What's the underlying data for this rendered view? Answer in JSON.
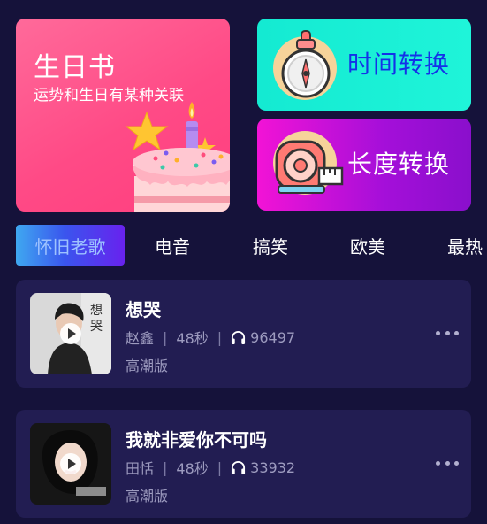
{
  "cards": {
    "birthday": {
      "title": "生日书",
      "subtitle": "运势和生日有某种关联",
      "icon": "birthday-cake-icon",
      "color": "#ff4a86"
    },
    "time": {
      "label": "时间转换",
      "icon": "compass-clock-icon",
      "color": "#1ff4d9"
    },
    "length": {
      "label": "长度转换",
      "icon": "tape-measure-icon",
      "color": "#c412d8"
    }
  },
  "tabs": [
    {
      "label": "怀旧老歌",
      "active": true
    },
    {
      "label": "电音",
      "active": false
    },
    {
      "label": "搞笑",
      "active": false
    },
    {
      "label": "欧美",
      "active": false
    },
    {
      "label": "最热",
      "active": false
    }
  ],
  "songs": [
    {
      "title": "想哭",
      "artist": "赵鑫",
      "duration": "48秒",
      "plays": "96497",
      "version": "高潮版"
    },
    {
      "title": "我就非爱你不可吗",
      "artist": "田恬",
      "duration": "48秒",
      "plays": "33932",
      "version": "高潮版"
    }
  ],
  "theme": {
    "background": "#15123a",
    "card_background": "#221d52",
    "muted_text": "#9d9bbf"
  }
}
